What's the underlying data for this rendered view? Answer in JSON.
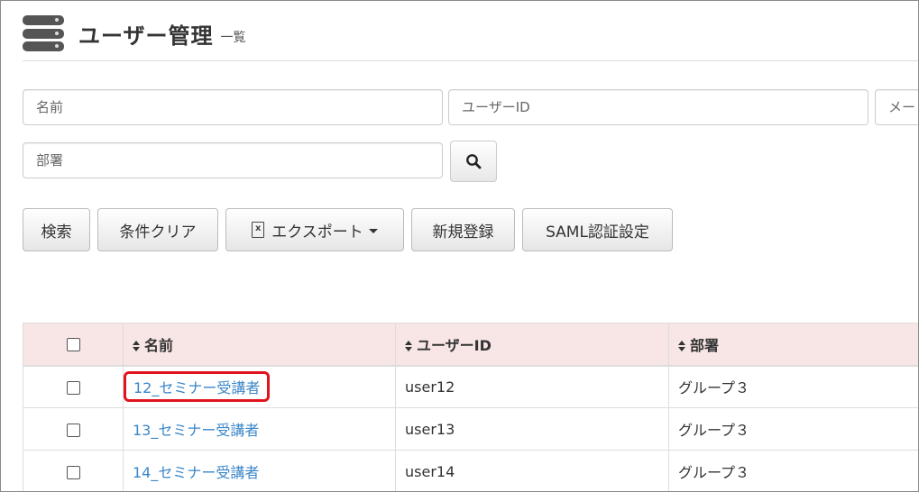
{
  "header": {
    "title": "ユーザー管理",
    "subtitle": "一覧",
    "icon": "database-icon"
  },
  "filters": {
    "name_placeholder": "名前",
    "user_id_placeholder": "ユーザーID",
    "mail_placeholder": "メー",
    "department_placeholder": "部署",
    "search_icon": "search-icon"
  },
  "toolbar": {
    "search_label": "検索",
    "clear_label": "条件クリア",
    "export_label": "エクスポート",
    "new_label": "新規登録",
    "saml_label": "SAML認証設定"
  },
  "table": {
    "columns": [
      "名前",
      "ユーザーID",
      "部署"
    ],
    "rows": [
      {
        "name": "12_セミナー受講者",
        "user_id": "user12",
        "department": "グループ３"
      },
      {
        "name": "13_セミナー受講者",
        "user_id": "user13",
        "department": "グループ３"
      },
      {
        "name": "14_セミナー受講者",
        "user_id": "user14",
        "department": "グループ３"
      }
    ]
  },
  "colors": {
    "header_row_bg": "#f8e5e5",
    "link": "#3a86c8",
    "highlight": "#e0141e"
  }
}
